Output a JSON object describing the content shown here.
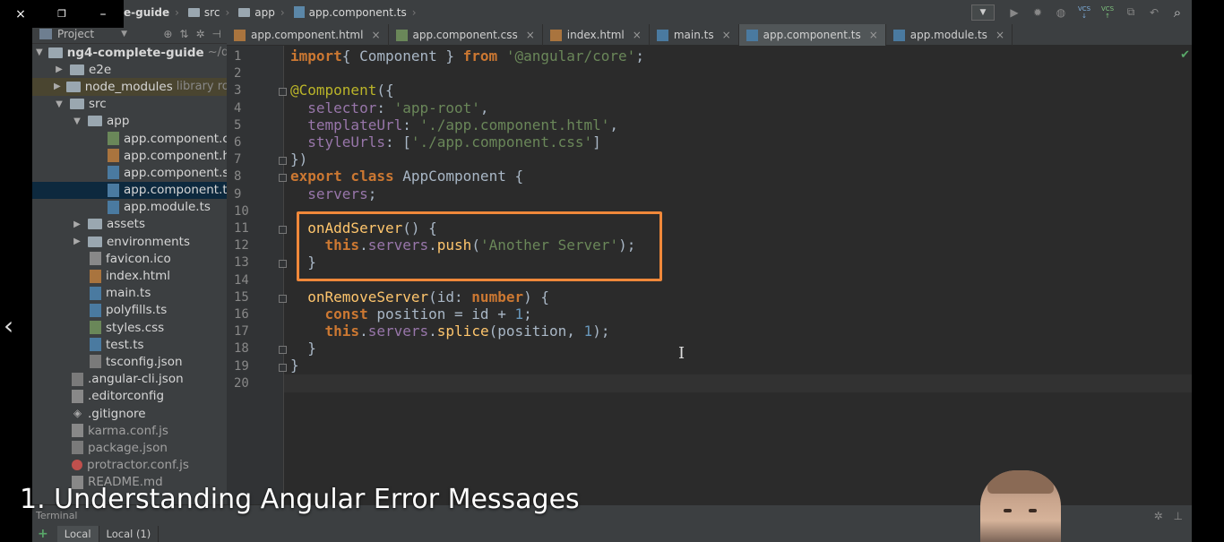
{
  "window": {
    "close_icon": "×",
    "restore_icon": "❐",
    "minimize_icon": "–"
  },
  "breadcrumb": [
    {
      "label": "e-guide",
      "kind": "project"
    },
    {
      "label": "src",
      "kind": "folder"
    },
    {
      "label": "app",
      "kind": "folder"
    },
    {
      "label": "app.component.ts",
      "kind": "ts"
    }
  ],
  "toolbar": {
    "vcs_label": "VCS"
  },
  "project_panel": {
    "title": "Project",
    "tree": [
      {
        "label": "ng4-complete-guide",
        "suffix": "~/dev",
        "indent": 0,
        "type": "folder",
        "arrow": "▼",
        "bold": true
      },
      {
        "label": "e2e",
        "indent": 1,
        "type": "folder",
        "arrow": "▶"
      },
      {
        "label": "node_modules",
        "suffix": "library roo",
        "indent": 1,
        "type": "folder",
        "arrow": "▶",
        "highlight": true
      },
      {
        "label": "src",
        "indent": 1,
        "type": "folder",
        "arrow": "▼"
      },
      {
        "label": "app",
        "indent": 2,
        "type": "folder",
        "arrow": "▼"
      },
      {
        "label": "app.component.cs",
        "indent": 4,
        "type": "css"
      },
      {
        "label": "app.component.ht",
        "indent": 4,
        "type": "html"
      },
      {
        "label": "app.component.sp",
        "indent": 4,
        "type": "ts"
      },
      {
        "label": "app.component.ts",
        "indent": 4,
        "type": "ts",
        "selected": true
      },
      {
        "label": "app.module.ts",
        "indent": 4,
        "type": "ts"
      },
      {
        "label": "assets",
        "indent": 2,
        "type": "folder",
        "arrow": "▶"
      },
      {
        "label": "environments",
        "indent": 2,
        "type": "folder",
        "arrow": "▶"
      },
      {
        "label": "favicon.ico",
        "indent": 3,
        "type": "plain"
      },
      {
        "label": "index.html",
        "indent": 3,
        "type": "html"
      },
      {
        "label": "main.ts",
        "indent": 3,
        "type": "ts"
      },
      {
        "label": "polyfills.ts",
        "indent": 3,
        "type": "ts"
      },
      {
        "label": "styles.css",
        "indent": 3,
        "type": "css"
      },
      {
        "label": "test.ts",
        "indent": 3,
        "type": "ts"
      },
      {
        "label": "tsconfig.json",
        "indent": 3,
        "type": "json"
      },
      {
        "label": ".angular-cli.json",
        "indent": 2,
        "type": "json"
      },
      {
        "label": ".editorconfig",
        "indent": 2,
        "type": "plain"
      },
      {
        "label": ".gitignore",
        "indent": 2,
        "type": "git"
      },
      {
        "label": "karma.conf.js",
        "indent": 2,
        "type": "plain",
        "muted": true
      },
      {
        "label": "package.json",
        "indent": 2,
        "type": "json",
        "muted": true
      },
      {
        "label": "protractor.conf.js",
        "indent": 2,
        "type": "red",
        "muted": true
      },
      {
        "label": "README.md",
        "indent": 2,
        "type": "plain",
        "muted": true
      }
    ]
  },
  "tabs": [
    {
      "label": "app.component.html",
      "type": "html"
    },
    {
      "label": "app.component.css",
      "type": "css"
    },
    {
      "label": "index.html",
      "type": "html"
    },
    {
      "label": "main.ts",
      "type": "ts"
    },
    {
      "label": "app.component.ts",
      "type": "ts",
      "active": true
    },
    {
      "label": "app.module.ts",
      "type": "ts"
    }
  ],
  "editor": {
    "line_numbers": [
      "1",
      "2",
      "3",
      "4",
      "5",
      "6",
      "7",
      "8",
      "9",
      "10",
      "11",
      "12",
      "13",
      "14",
      "15",
      "16",
      "17",
      "18",
      "19",
      "20"
    ],
    "code_lines": [
      [
        [
          "kw",
          "import"
        ],
        [
          "",
          "{ Component } "
        ],
        [
          "kw",
          "from"
        ],
        [
          "str",
          " '@angular/core'"
        ],
        [
          "",
          ";"
        ]
      ],
      [],
      [
        [
          "ann",
          "@Component"
        ],
        [
          "",
          "({"
        ]
      ],
      [
        [
          "prop",
          "  selector"
        ],
        [
          "",
          ": "
        ],
        [
          "str",
          "'app-root'"
        ],
        [
          "",
          ","
        ]
      ],
      [
        [
          "prop",
          "  templateUrl"
        ],
        [
          "",
          ": "
        ],
        [
          "str",
          "'./app.component.html'"
        ],
        [
          "",
          ","
        ]
      ],
      [
        [
          "prop",
          "  styleUrls"
        ],
        [
          "",
          ": ["
        ],
        [
          "str",
          "'./app.component.css'"
        ],
        [
          "",
          "]"
        ]
      ],
      [
        [
          "",
          "})"
        ]
      ],
      [
        [
          "kw",
          "export class "
        ],
        [
          "",
          "AppComponent {"
        ]
      ],
      [
        [
          "prop",
          "  servers"
        ],
        [
          "",
          ";"
        ]
      ],
      [],
      [
        [
          "fn",
          "  onAddServer"
        ],
        [
          "",
          "() {"
        ]
      ],
      [
        [
          "kw",
          "    this"
        ],
        [
          "",
          "."
        ],
        [
          "prop",
          "servers"
        ],
        [
          "",
          "."
        ],
        [
          "fn",
          "push"
        ],
        [
          "",
          "("
        ],
        [
          "str",
          "'Another Server'"
        ],
        [
          "",
          ");"
        ]
      ],
      [
        [
          "",
          "  }"
        ]
      ],
      [],
      [
        [
          "fn",
          "  onRemoveServer"
        ],
        [
          "",
          "(id: "
        ],
        [
          "kw",
          "number"
        ],
        [
          "",
          ") {"
        ]
      ],
      [
        [
          "kw",
          "    const "
        ],
        [
          "",
          "position = id + "
        ],
        [
          "num",
          "1"
        ],
        [
          "",
          ";"
        ]
      ],
      [
        [
          "kw",
          "    this"
        ],
        [
          "",
          "."
        ],
        [
          "prop",
          "servers"
        ],
        [
          "",
          "."
        ],
        [
          "fn",
          "splice"
        ],
        [
          "",
          "(position, "
        ],
        [
          "num",
          "1"
        ],
        [
          "",
          ");"
        ]
      ],
      [
        [
          "",
          "  }"
        ]
      ],
      [
        [
          "",
          "}"
        ]
      ],
      []
    ]
  },
  "terminal": {
    "title": "Terminal",
    "tabs": [
      "Local",
      "Local (1)"
    ]
  },
  "caption": "1. Understanding Angular Error Messages"
}
